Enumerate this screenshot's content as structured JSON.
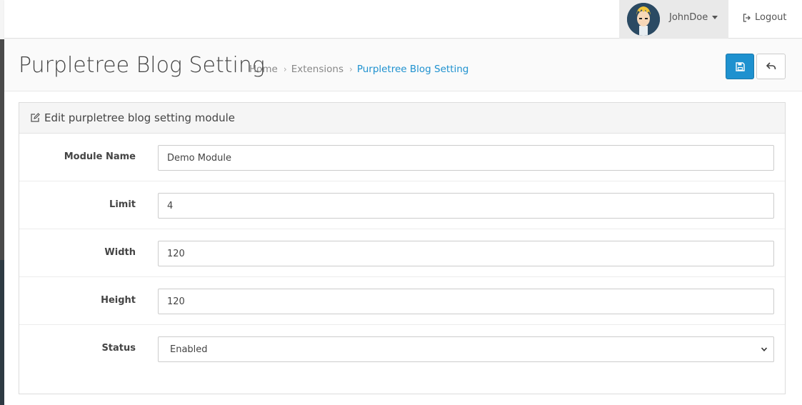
{
  "header": {
    "user_name": "JohnDoe",
    "logout_label": "Logout"
  },
  "page": {
    "title": "Purpletree Blog Setting",
    "breadcrumb": [
      "Home",
      "Extensions",
      "Purpletree Blog Setting"
    ],
    "accent_color": "#1e91cf"
  },
  "panel": {
    "heading": "Edit purpletree blog setting module",
    "fields": [
      {
        "label": "Module Name",
        "value": "Demo Module"
      },
      {
        "label": "Limit",
        "value": "4"
      },
      {
        "label": "Width",
        "value": "120"
      },
      {
        "label": "Height",
        "value": "120"
      },
      {
        "label": "Status",
        "value": "Enabled"
      }
    ]
  },
  "icons": {
    "save": "save-icon",
    "back": "reply-icon",
    "logout": "sign-out-icon",
    "edit": "pencil-square-icon",
    "user_caret": "caret-down-icon",
    "select_chevron": "chevron-down-icon"
  }
}
